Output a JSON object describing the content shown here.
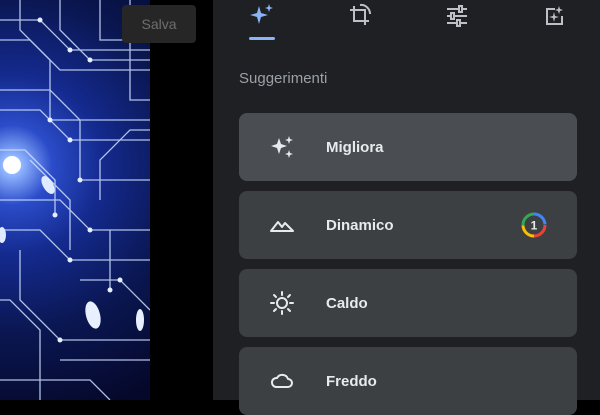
{
  "toolbar": {
    "save_label": "Salva"
  },
  "tabs": [
    {
      "icon": "sparkle-icon",
      "active": true
    },
    {
      "icon": "crop-rotate-icon",
      "active": false
    },
    {
      "icon": "sliders-icon",
      "active": false
    },
    {
      "icon": "add-photo-icon",
      "active": false
    }
  ],
  "suggestions": {
    "title": "Suggerimenti",
    "items": [
      {
        "label": "Migliora",
        "icon": "sparkle-icon",
        "selected": true
      },
      {
        "label": "Dinamico",
        "icon": "mountains-icon",
        "badge": "1"
      },
      {
        "label": "Caldo",
        "icon": "sun-icon"
      },
      {
        "label": "Freddo",
        "icon": "cloud-icon"
      }
    ]
  },
  "colors": {
    "panel_bg": "#1f2023",
    "card_bg": "#3c4043",
    "card_selected_bg": "#4a4d51",
    "accent": "#8ab4f8"
  }
}
